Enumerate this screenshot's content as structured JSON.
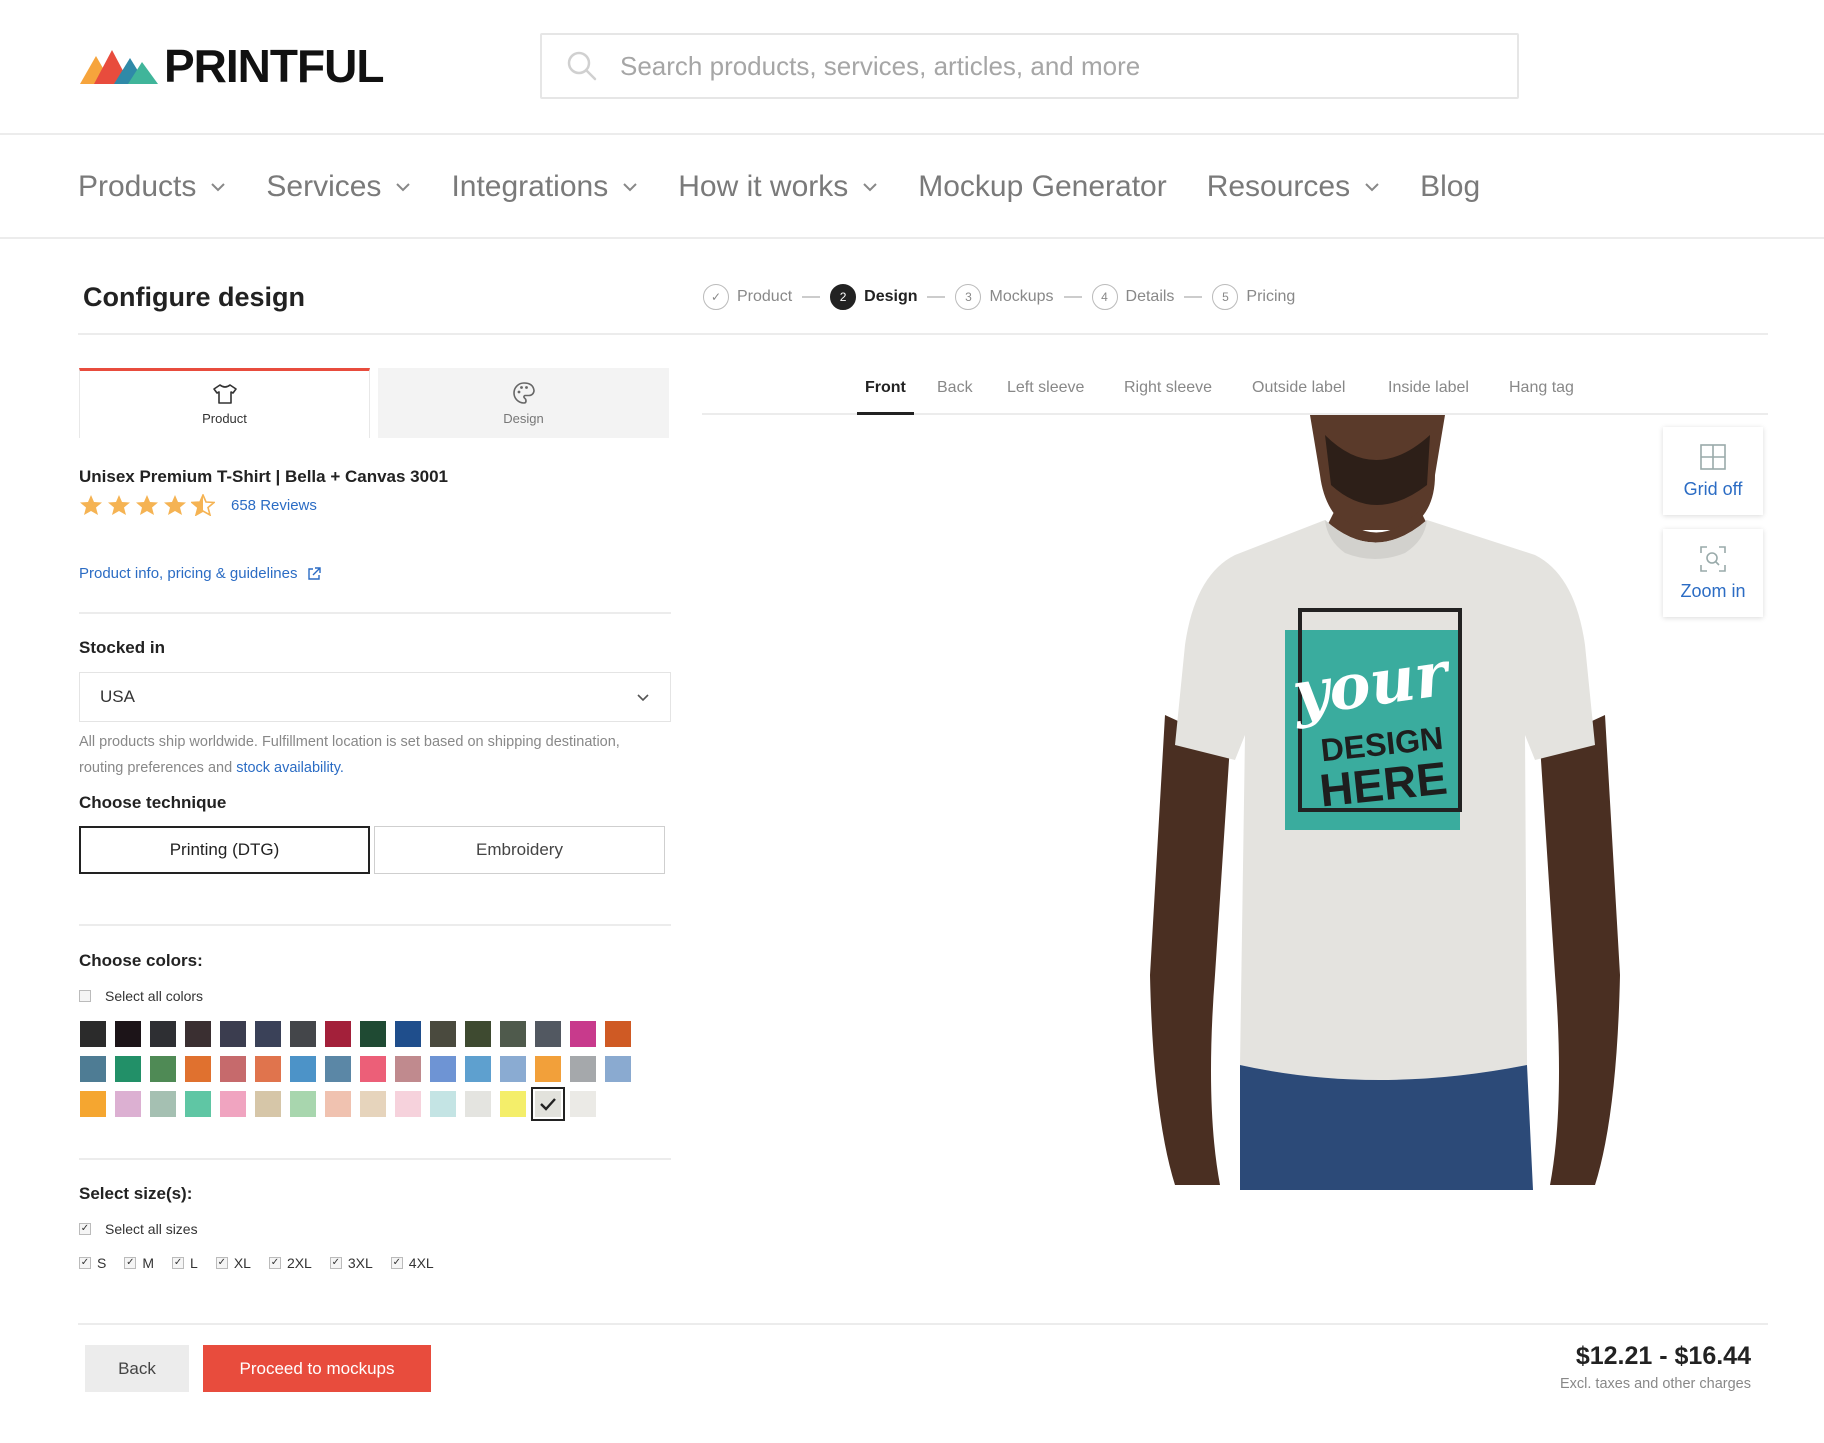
{
  "brand": {
    "name": "PRINTFUL"
  },
  "search": {
    "placeholder": "Search products, services, articles, and more"
  },
  "nav": [
    {
      "label": "Products",
      "dropdown": true
    },
    {
      "label": "Services",
      "dropdown": true
    },
    {
      "label": "Integrations",
      "dropdown": true
    },
    {
      "label": "How it works",
      "dropdown": true
    },
    {
      "label": "Mockup Generator",
      "dropdown": false
    },
    {
      "label": "Resources",
      "dropdown": true
    },
    {
      "label": "Blog",
      "dropdown": false
    }
  ],
  "config": {
    "title": "Configure design"
  },
  "steps": [
    {
      "num": "✓",
      "label": "Product",
      "state": "done"
    },
    {
      "num": "2",
      "label": "Design",
      "state": "active"
    },
    {
      "num": "3",
      "label": "Mockups",
      "state": "todo"
    },
    {
      "num": "4",
      "label": "Details",
      "state": "todo"
    },
    {
      "num": "5",
      "label": "Pricing",
      "state": "todo"
    }
  ],
  "panel_tabs": {
    "product": "Product",
    "design": "Design"
  },
  "product": {
    "name": "Unisex Premium T-Shirt | Bella + Canvas 3001",
    "rating": 4.5,
    "reviews": "658 Reviews",
    "info_link": "Product info, pricing & guidelines"
  },
  "stocked": {
    "label": "Stocked in",
    "value": "USA",
    "note_text": "All products ship worldwide. Fulfillment location is set based on shipping destination, routing preferences and ",
    "note_link": "stock availability."
  },
  "technique": {
    "label": "Choose technique",
    "options": [
      "Printing (DTG)",
      "Embroidery"
    ],
    "selected": "Printing (DTG)"
  },
  "colors": {
    "label": "Choose colors:",
    "select_all": "Select all colors",
    "select_all_checked": false,
    "selected_index": 45,
    "swatches": [
      "#2b2b2b",
      "#1c1418",
      "#2e2f33",
      "#3a2f31",
      "#3b3d4f",
      "#3a4158",
      "#44464a",
      "#a3203a",
      "#1f4a33",
      "#1f4e8c",
      "#4a4a3e",
      "#3e4a30",
      "#4f5a4c",
      "#525861",
      "#c83a8c",
      "#cf5a24",
      "#4e7c94",
      "#229068",
      "#4f8a55",
      "#e0712f",
      "#c66a6c",
      "#e0744d",
      "#4c93c8",
      "#5b87a6",
      "#ec5f78",
      "#c08a8e",
      "#6e94d4",
      "#5ea0cf",
      "#8aabd2",
      "#f2a03a",
      "#a5a8ab",
      "#8aaad0",
      "#f5a630",
      "#dcb0d2",
      "#a5c0b2",
      "#5fc6a4",
      "#f0a4c0",
      "#d6c6a8",
      "#a8d6ae",
      "#f0c2b0",
      "#e6d4bc",
      "#f6d2dc",
      "#c4e4e4",
      "#e4e4e0",
      "#f4ee6a",
      "#e2e2dc",
      "#ebeae6"
    ]
  },
  "sizes": {
    "label": "Select size(s):",
    "select_all": "Select all sizes",
    "select_all_checked": true,
    "options": [
      "S",
      "M",
      "L",
      "XL",
      "2XL",
      "3XL",
      "4XL"
    ]
  },
  "view_tabs": [
    "Front",
    "Back",
    "Left sleeve",
    "Right sleeve",
    "Outside label",
    "Inside label",
    "Hang tag"
  ],
  "view_active": "Front",
  "mockup": {
    "shirt_color": "#e4e3df",
    "design_color": "#3aac9e",
    "design_line1": "your",
    "design_line2": "DESIGN",
    "design_line3": "HERE"
  },
  "tools": {
    "grid": "Grid off",
    "zoom": "Zoom in"
  },
  "footer": {
    "back": "Back",
    "proceed": "Proceed to mockups",
    "price": "$12.21 - $16.44",
    "price_note": "Excl. taxes and other charges"
  }
}
